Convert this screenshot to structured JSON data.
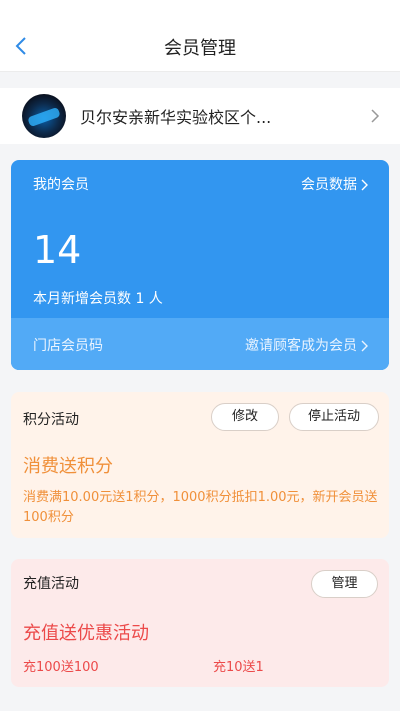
{
  "nav": {
    "title": "会员管理",
    "back_icon": "back-chevron-icon"
  },
  "store": {
    "name": "贝尔安亲新华实验校区个...",
    "chevron_icon": "chevron-right-icon"
  },
  "member_card": {
    "title": "我的会员",
    "data_link": "会员数据",
    "count": "14",
    "new_members": "本月新增会员数 1 人",
    "store_code": "门店会员码",
    "invite_link": "邀请顾客成为会员",
    "color": "#3296f0"
  },
  "points_activity": {
    "title": "积分活动",
    "edit_label": "修改",
    "stop_label": "停止活动",
    "headline": "消费送积分",
    "description": "消费满10.00元送1积分，1000积分抵扣1.00元，新开会员送100积分",
    "accent_color": "#f0903a"
  },
  "recharge_activity": {
    "title": "充值活动",
    "manage_label": "管理",
    "headline": "充值送优惠活动",
    "options": [
      "充100送100",
      "充10送1"
    ],
    "accent_color": "#ec4a4a"
  }
}
